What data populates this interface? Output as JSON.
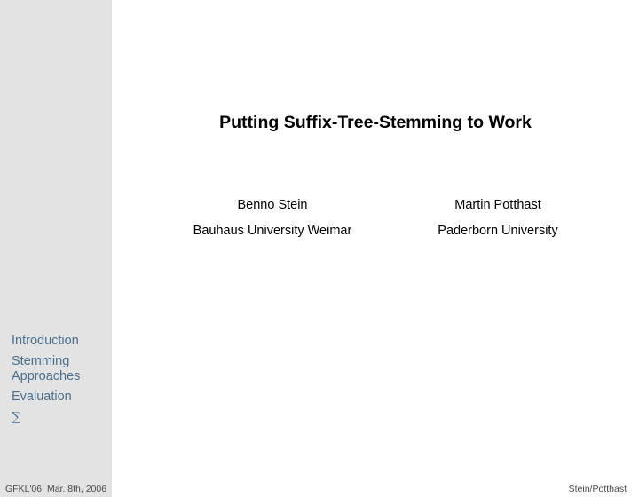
{
  "title": "Putting Suffix-Tree-Stemming to Work",
  "authors": [
    {
      "name": "Benno Stein",
      "affiliation": "Bauhaus University Weimar"
    },
    {
      "name": "Martin Potthast",
      "affiliation": "Paderborn University"
    }
  ],
  "sidebar": {
    "items": [
      {
        "label": "Introduction"
      },
      {
        "label": "Stemming Approaches"
      },
      {
        "label": "Evaluation"
      },
      {
        "label": "∑"
      }
    ]
  },
  "footer": {
    "left": "GFKL'06  Mar. 8th, 2006",
    "right": "Stein/Potthast"
  },
  "colors": {
    "sidebar_bg": "#e3e3e3",
    "nav_link": "#4a6f8f"
  }
}
